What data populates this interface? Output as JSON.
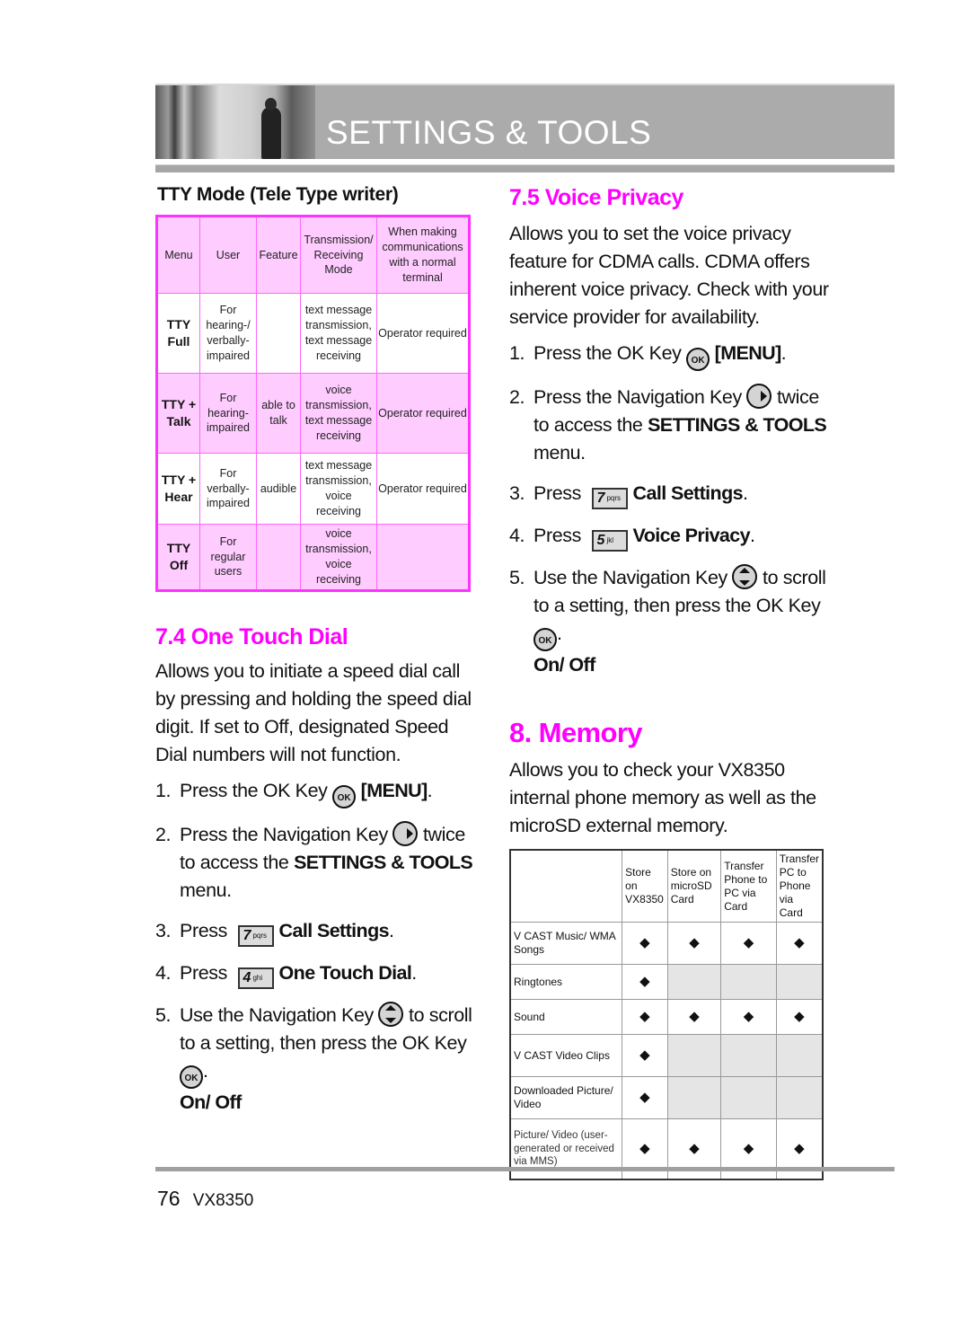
{
  "header": {
    "title": "SETTINGS & TOOLS"
  },
  "tty": {
    "heading": "TTY Mode (Tele Type writer)",
    "columns": [
      "Menu",
      "User",
      "Feature",
      "Transmission/ Receiving Mode",
      "When making communications with a normal terminal"
    ],
    "rows": [
      {
        "menu": "TTY Full",
        "user": "For hearing-/ verbally-impaired",
        "feature": "",
        "mode": "text message transmission, text message receiving",
        "normal": "Operator required"
      },
      {
        "menu": "TTY + Talk",
        "user": "For hearing-impaired",
        "feature": "able to talk",
        "mode": "voice transmission, text message receiving",
        "normal": "Operator required"
      },
      {
        "menu": "TTY + Hear",
        "user": "For verbally-impaired",
        "feature": "audible",
        "mode": "text message transmission, voice receiving",
        "normal": "Operator required"
      },
      {
        "menu": "TTY Off",
        "user": "For regular users",
        "feature": "",
        "mode": "voice transmission, voice receiving",
        "normal": ""
      }
    ]
  },
  "one_touch": {
    "title": "7.4 One Touch Dial",
    "description": "Allows you to initiate a speed dial call by pressing and holding the speed dial digit. If set to Off, designated Speed Dial numbers will not function.",
    "steps": [
      {
        "num": "1.",
        "pre": "Press the OK Key",
        "icon": "ok-key",
        "bold": "[MENU]",
        "post": "."
      },
      {
        "num": "2.",
        "pre": "Press the Navigation Key",
        "icon": "nav-right-key",
        "mid": "twice to access the",
        "bold": "SETTINGS & TOOLS",
        "post": "menu."
      },
      {
        "num": "3.",
        "pre": "Press",
        "key_digit": "7",
        "key_letters": "pqrs",
        "bold": "Call Settings",
        "post": "."
      },
      {
        "num": "4.",
        "pre": "Press",
        "key_digit": "4",
        "key_letters": "ghi",
        "bold": "One Touch Dial",
        "post": "."
      },
      {
        "num": "5.",
        "pre": "Use the Navigation Key",
        "icon": "nav-updown-key",
        "mid": "to scroll to a setting, then press the OK Key",
        "post": ".",
        "option": "On/ Off"
      }
    ]
  },
  "voice_privacy": {
    "title": "7.5 Voice Privacy",
    "description": "Allows you to set the voice privacy feature for CDMA calls. CDMA offers inherent voice privacy. Check with your service provider for availability.",
    "steps": [
      {
        "num": "1.",
        "pre": "Press the OK Key",
        "icon": "ok-key",
        "bold": "[MENU]",
        "post": "."
      },
      {
        "num": "2.",
        "pre": "Press the Navigation Key",
        "icon": "nav-right-key",
        "mid": "twice to access the",
        "bold": "SETTINGS & TOOLS",
        "post": "menu."
      },
      {
        "num": "3.",
        "pre": "Press",
        "key_digit": "7",
        "key_letters": "pqrs",
        "bold": "Call Settings",
        "post": "."
      },
      {
        "num": "4.",
        "pre": "Press",
        "key_digit": "5",
        "key_letters": "jkl",
        "bold": "Voice Privacy",
        "post": "."
      },
      {
        "num": "5.",
        "pre": "Use the Navigation Key",
        "icon": "nav-updown-key",
        "mid": "to scroll to a setting, then press the OK Key",
        "post": ".",
        "option": "On/ Off"
      }
    ]
  },
  "memory": {
    "title": "8. Memory",
    "description": "Allows you to check your VX8350 internal phone memory as well as the microSD external memory.",
    "columns": [
      "",
      "Store on VX8350",
      "Store on microSD Card",
      "Transfer Phone to PC via Card",
      "Transfer PC to Phone via Card"
    ],
    "diamond": "◆",
    "rows": [
      {
        "label": "V CAST Music/ WMA Songs",
        "cells": [
          true,
          true,
          true,
          true
        ]
      },
      {
        "label": "Ringtones",
        "cells": [
          true,
          false,
          false,
          false
        ]
      },
      {
        "label": "Sound",
        "cells": [
          true,
          true,
          true,
          true
        ]
      },
      {
        "label": "V CAST Video Clips",
        "cells": [
          true,
          false,
          false,
          false
        ]
      },
      {
        "label": "Downloaded Picture/ Video",
        "cells": [
          true,
          false,
          false,
          false
        ]
      },
      {
        "label": "Picture/ Video (user-generated or received via MMS)",
        "cells": [
          true,
          true,
          true,
          true
        ]
      }
    ]
  },
  "footer": {
    "page": "76",
    "model": "VX8350"
  },
  "colors": {
    "accent": "#ff00ff",
    "table_pink": "#ffccff",
    "banner_grey": "#ababab"
  }
}
